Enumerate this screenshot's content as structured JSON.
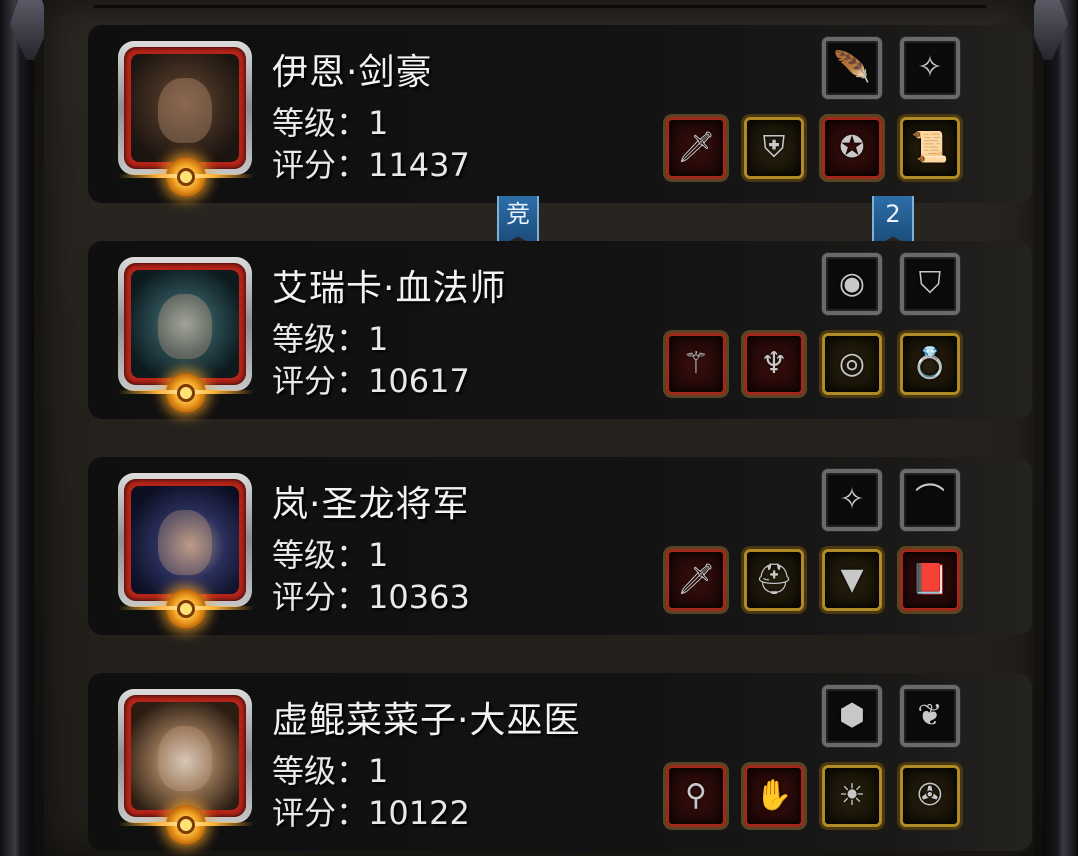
{
  "heroes": [
    {
      "name": "伊恩·剑豪",
      "level_text": "等级：1",
      "score_text": "评分：11437",
      "portrait": "bearded-warrior-portrait",
      "top_slots": [
        {
          "icon": "feather-icon",
          "glyph": "🪶"
        },
        {
          "icon": "emblem-icon",
          "glyph": "✧"
        }
      ],
      "gear_slots": [
        {
          "icon": "sword-icon",
          "glyph": "🗡",
          "frame": "red"
        },
        {
          "icon": "armor-icon",
          "glyph": "⛨",
          "frame": "gold"
        },
        {
          "icon": "amulet-icon",
          "glyph": "✪",
          "frame": "red"
        },
        {
          "icon": "scroll-icon",
          "glyph": "📜",
          "frame": "gold"
        }
      ]
    },
    {
      "name": "艾瑞卡·血法师",
      "level_text": "等级：1",
      "score_text": "评分：10617",
      "portrait": "hooded-mage-portrait",
      "top_slots": [
        {
          "icon": "eye-orb-icon",
          "glyph": "◉"
        },
        {
          "icon": "crest-shield-icon",
          "glyph": "⛉"
        }
      ],
      "gear_slots": [
        {
          "icon": "staff-icon",
          "glyph": "⚚",
          "frame": "red"
        },
        {
          "icon": "robe-icon",
          "glyph": "♆",
          "frame": "red"
        },
        {
          "icon": "eye-pendant-icon",
          "glyph": "◎",
          "frame": "gold"
        },
        {
          "icon": "ring-icon",
          "glyph": "💍",
          "frame": "gold"
        }
      ]
    },
    {
      "name": "岚·圣龙将军",
      "level_text": "等级：1",
      "score_text": "评分：10363",
      "portrait": "blue-haired-general-portrait",
      "top_slots": [
        {
          "icon": "emblem-icon",
          "glyph": "✧"
        },
        {
          "icon": "horn-icon",
          "glyph": "⌒"
        }
      ],
      "gear_slots": [
        {
          "icon": "greatsword-icon",
          "glyph": "🗡",
          "frame": "red"
        },
        {
          "icon": "helmet-icon",
          "glyph": "⛑",
          "frame": "gold"
        },
        {
          "icon": "cape-icon",
          "glyph": "▼",
          "frame": "gold"
        },
        {
          "icon": "tome-icon",
          "glyph": "📕",
          "frame": "red"
        }
      ]
    },
    {
      "name": "虚鲲菜菜子·大巫医",
      "level_text": "等级：1",
      "score_text": "评分：10122",
      "portrait": "elder-shaman-portrait",
      "top_slots": [
        {
          "icon": "shell-icon",
          "glyph": "⬢"
        },
        {
          "icon": "wing-icon",
          "glyph": "❦"
        }
      ],
      "gear_slots": [
        {
          "icon": "scepter-icon",
          "glyph": "⚲",
          "frame": "red"
        },
        {
          "icon": "gauntlet-icon",
          "glyph": "✋",
          "frame": "red"
        },
        {
          "icon": "sun-charm-icon",
          "glyph": "☀",
          "frame": "gold"
        },
        {
          "icon": "claw-icon",
          "glyph": "✇",
          "frame": "gold"
        }
      ]
    }
  ],
  "ribbons": [
    {
      "label": "竞"
    },
    {
      "label": "2"
    }
  ]
}
